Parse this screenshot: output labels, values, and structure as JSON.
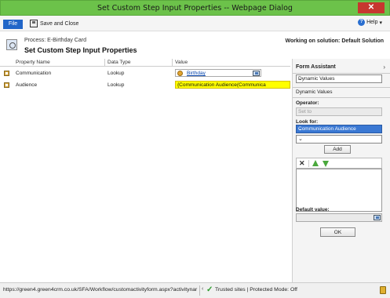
{
  "window": {
    "title": "Set Custom Step Input Properties -- Webpage Dialog",
    "close_glyph": "✕"
  },
  "ribbon": {
    "file_label": "File",
    "save_close_label": "Save and Close",
    "help_label": "Help",
    "help_caret": "▾",
    "help_glyph": "?"
  },
  "header": {
    "process_label": "Process: E-Birthday Card",
    "title": "Set Custom Step Input Properties",
    "solution_text": "Working on solution: Default Solution"
  },
  "grid": {
    "columns": [
      "Property Name",
      "Data Type",
      "Value"
    ],
    "rows": [
      {
        "name": "Communication",
        "type": "Lookup",
        "value": "Birthday"
      },
      {
        "name": "Audience",
        "type": "Lookup",
        "value": "{Communication Audience(Communica"
      }
    ]
  },
  "form_assistant": {
    "title": "Form Assistant",
    "collapse_glyph": "›",
    "type_select": "Dynamic Values",
    "section_label": "Dynamic Values",
    "operator_label": "Operator:",
    "operator_value": "Set to",
    "look_for_label": "Look for:",
    "look_for_value": "Communication Audience",
    "look_for_attr_value": "",
    "add_label": "Add",
    "remove_glyph": "✕",
    "default_label": "Default value:",
    "ok_label": "OK",
    "caret": "⌄"
  },
  "status_bar": {
    "url": "https://green4.green4crm.co.uk/SFA/Workflow/customactivityform.aspx?activitynar",
    "scroll_glyph": "‹",
    "check_glyph": "✓",
    "zone": "Trusted sites | Protected Mode: Off"
  },
  "colors": {
    "titlebar": "#6cc24a",
    "file": "#2266c8",
    "highlight": "#ffff00",
    "selected": "#3a78d3"
  }
}
